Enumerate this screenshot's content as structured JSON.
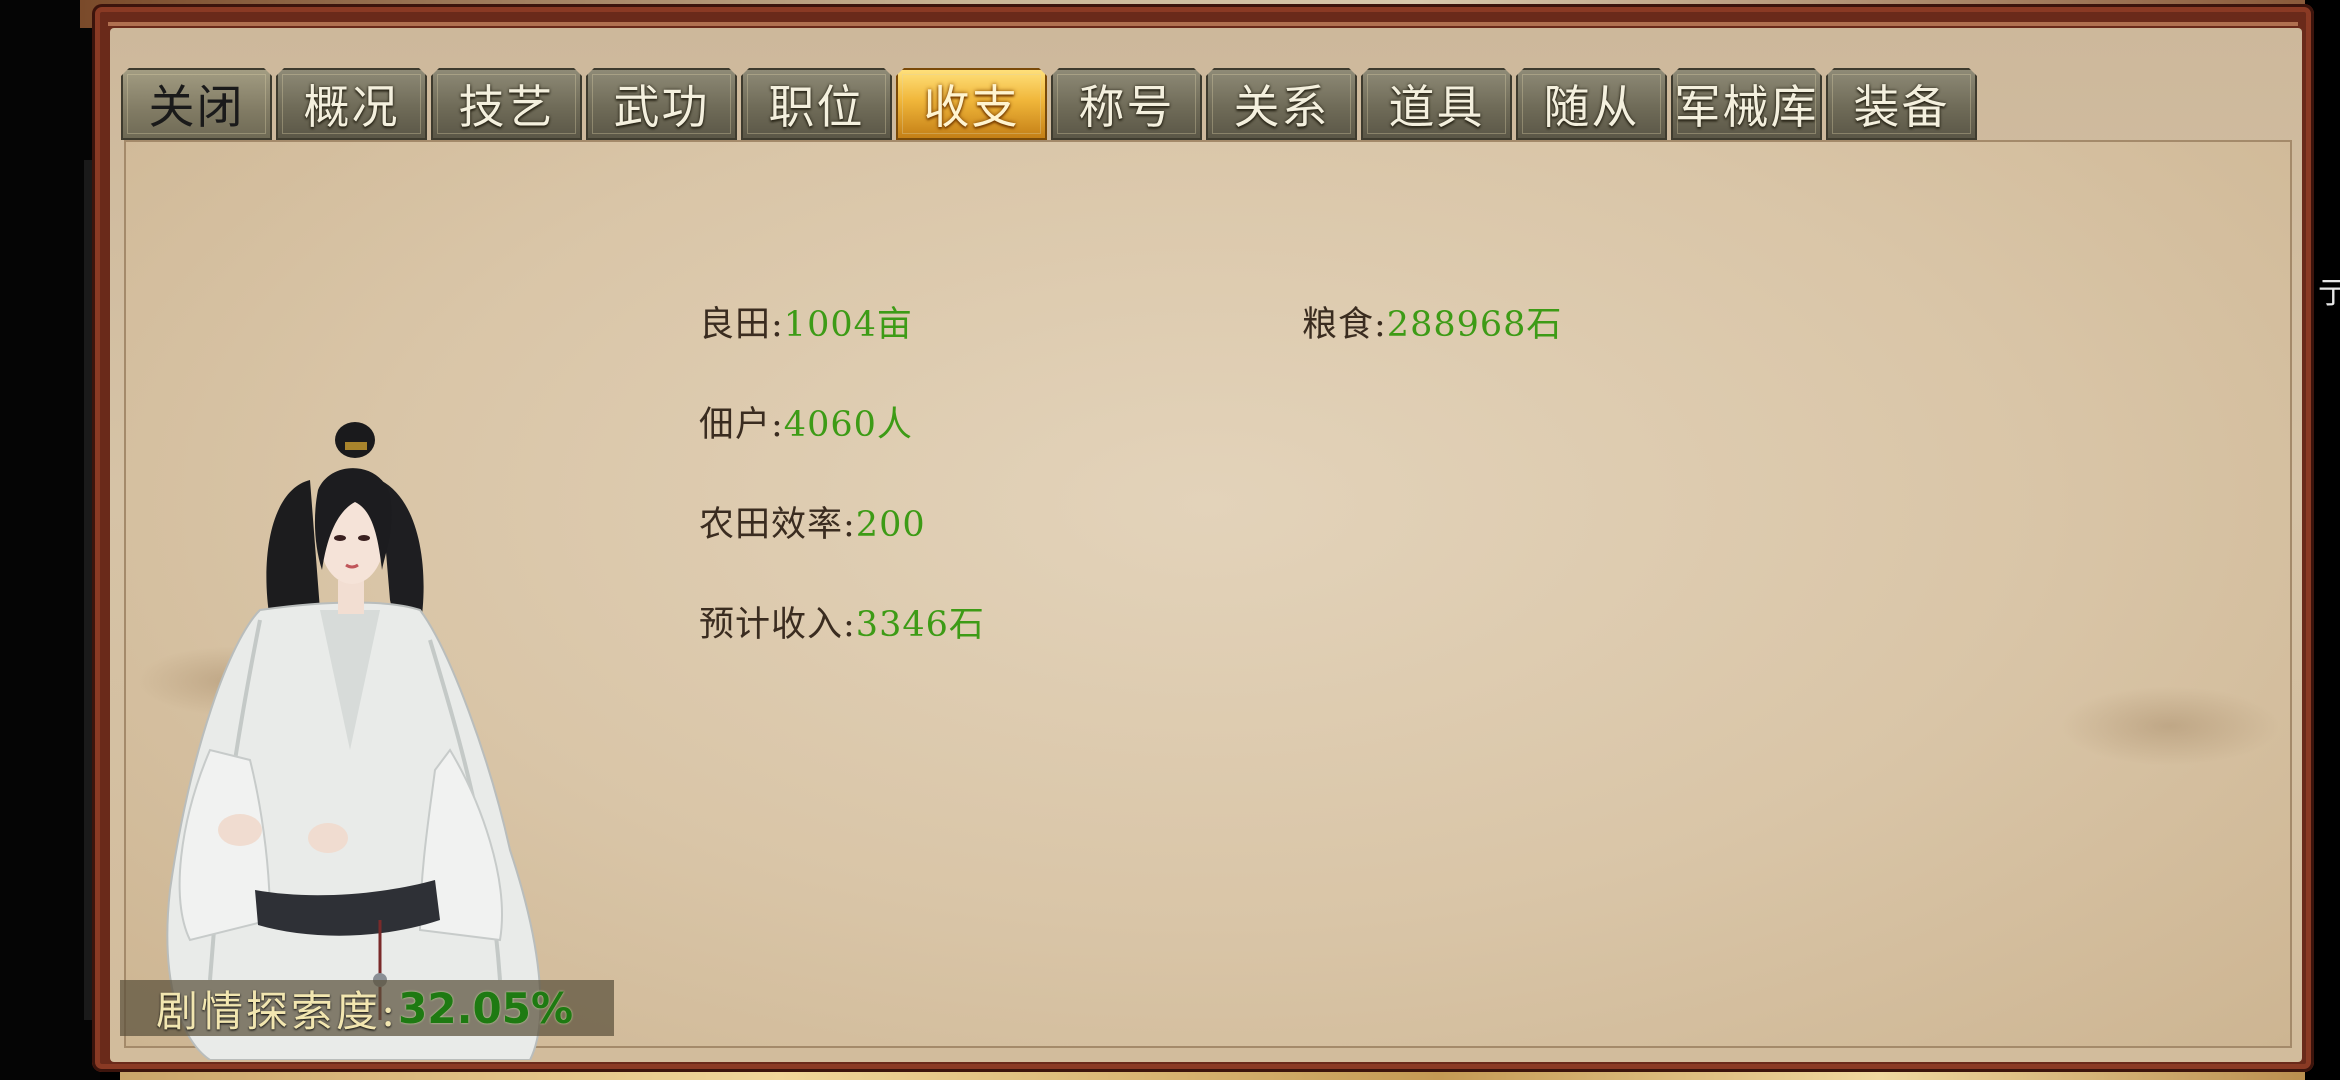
{
  "tabs": [
    {
      "label": "关闭",
      "active": false
    },
    {
      "label": "概况",
      "active": false
    },
    {
      "label": "技艺",
      "active": false
    },
    {
      "label": "武功",
      "active": false
    },
    {
      "label": "职位",
      "active": false
    },
    {
      "label": "收支",
      "active": true
    },
    {
      "label": "称号",
      "active": false
    },
    {
      "label": "关系",
      "active": false
    },
    {
      "label": "道具",
      "active": false
    },
    {
      "label": "随从",
      "active": false
    },
    {
      "label": "军械库",
      "active": false
    },
    {
      "label": "装备",
      "active": false
    }
  ],
  "stats": {
    "farmland": {
      "label": "良田:",
      "value": "1004亩"
    },
    "grain": {
      "label": "粮食:",
      "value": "288968石"
    },
    "tenants": {
      "label": "佃户:",
      "value": "4060人"
    },
    "efficiency": {
      "label": "农田效率:",
      "value": "200"
    },
    "income": {
      "label": "预计收入:",
      "value": "3346石"
    }
  },
  "story_progress": {
    "label": "剧情探索度:",
    "value": "32.05%"
  },
  "right_edge_fragment": "亍",
  "colors": {
    "value_green": "#3d9b16",
    "label_brown": "#3a2c20",
    "active_tab_gold": "#f0b63a",
    "frame_red": "#6a2a1a"
  }
}
